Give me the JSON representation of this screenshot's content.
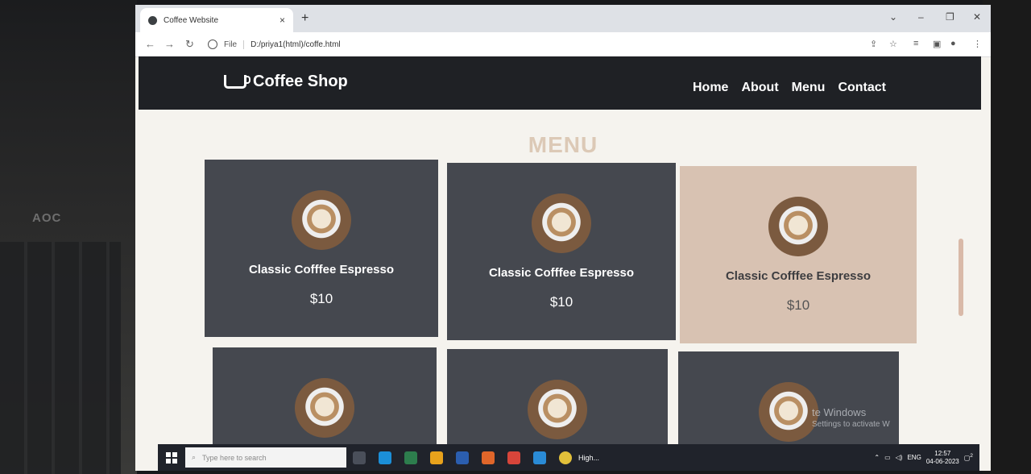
{
  "monitor_brand": "AOC",
  "browser": {
    "tab_title": "Coffee Website",
    "tab_close": "×",
    "new_tab": "+",
    "address_scheme": "File",
    "address_url": "D:/priya1(html)/coffe.html"
  },
  "site": {
    "logo_text": "Coffee Shop",
    "nav": [
      "Home",
      "About",
      "Menu",
      "Contact"
    ],
    "section_title": "MENU",
    "items": [
      {
        "name": "Classic Cofffee Espresso",
        "price": "$10"
      },
      {
        "name": "Classic Cofffee Espresso",
        "price": "$10"
      },
      {
        "name": "Classic Cofffee Espresso",
        "price": "$10"
      }
    ]
  },
  "watermark": {
    "line1": "te Windows",
    "line2": "Settings to activate W"
  },
  "taskbar": {
    "search_placeholder": "Type here to search",
    "pinned_label": "High...",
    "lang": "ENG",
    "time": "12:57",
    "date": "04-06-2023",
    "notification_count": "2"
  },
  "colors": {
    "header_bg": "#1f2125",
    "card_dark": "#45484f",
    "card_light": "#d8c2b2",
    "title_accent": "#dcc9b6"
  }
}
